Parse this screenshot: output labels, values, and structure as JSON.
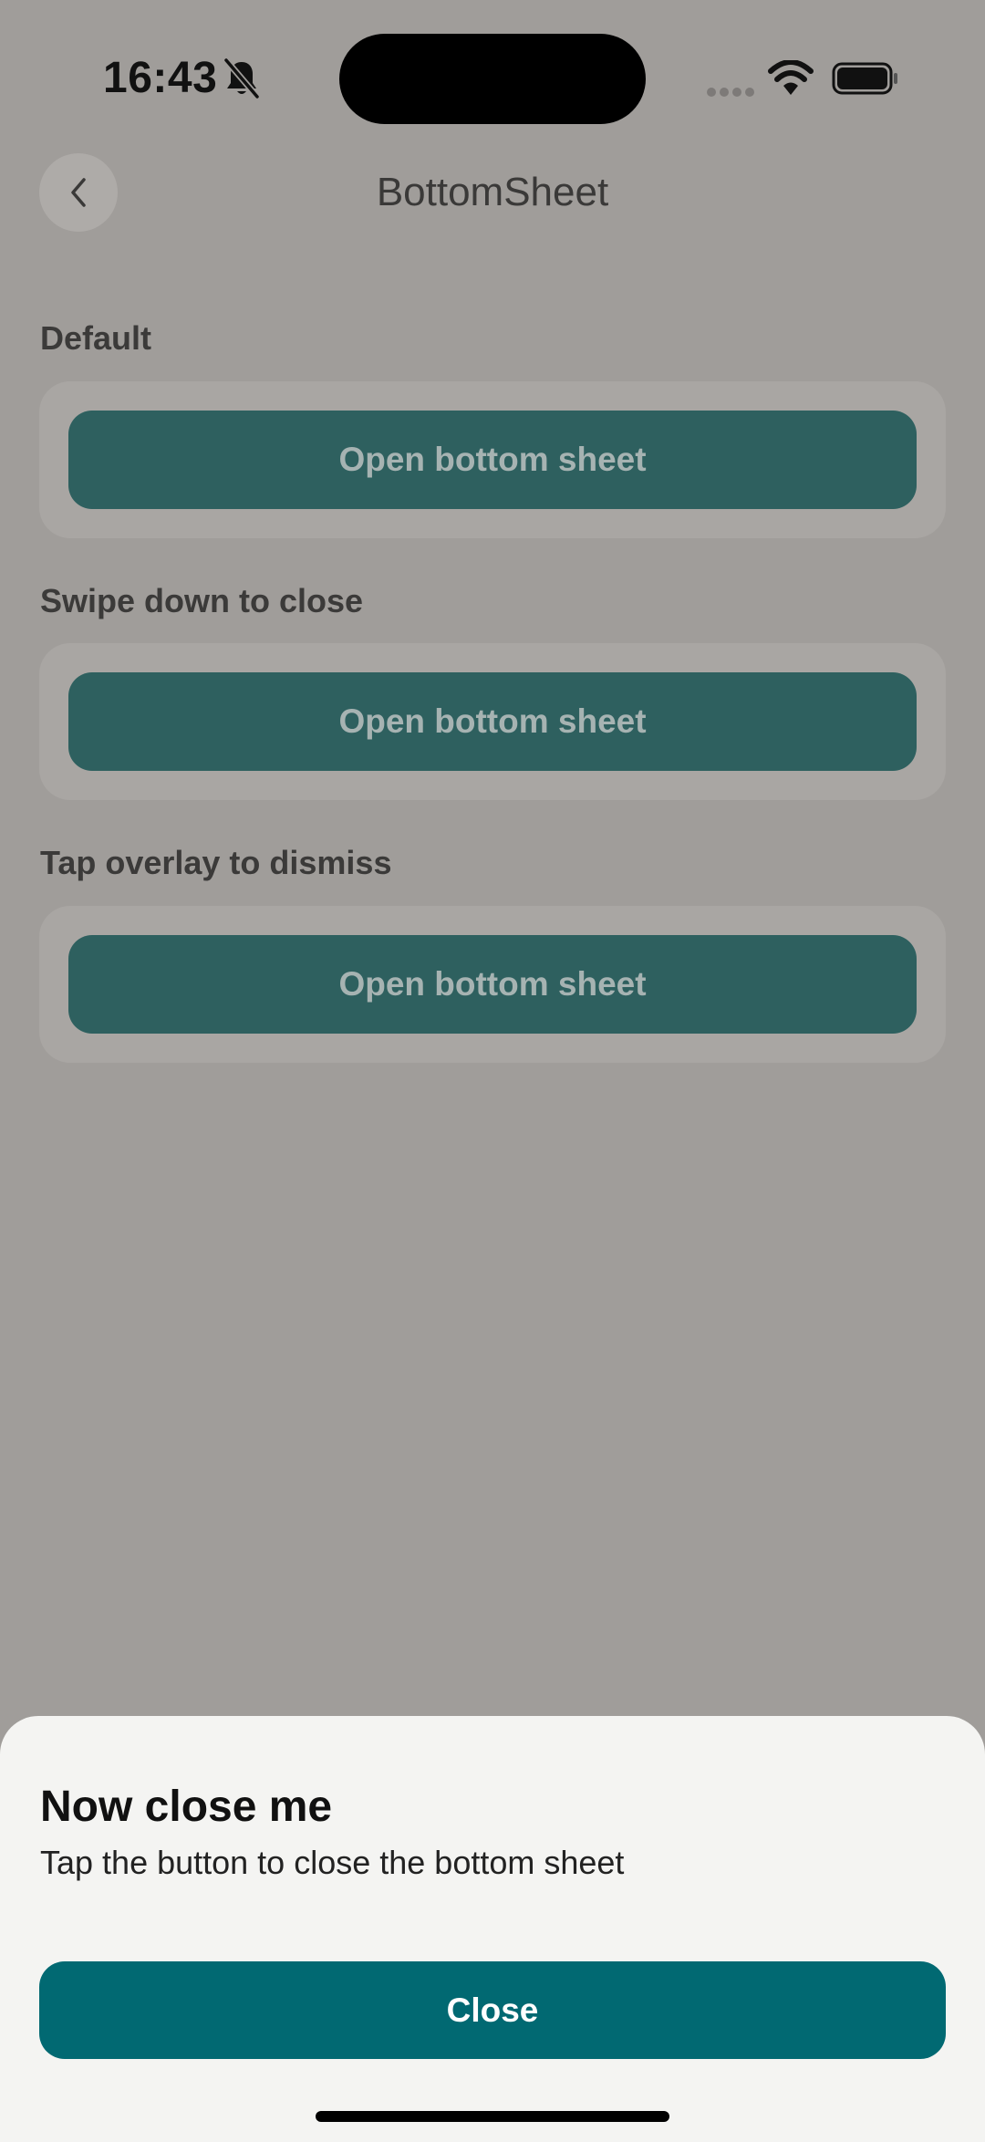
{
  "status_bar": {
    "time": "16:43",
    "icons": [
      "bell-slash-icon",
      "signal-dots-icon",
      "wifi-icon",
      "battery-icon"
    ]
  },
  "header": {
    "title": "BottomSheet",
    "back_icon": "chevron-left-icon"
  },
  "sections": [
    {
      "label": "Default",
      "button_label": "Open bottom sheet"
    },
    {
      "label": "Swipe down to close",
      "button_label": "Open bottom sheet"
    },
    {
      "label": "Tap overlay to dismiss",
      "button_label": "Open bottom sheet"
    }
  ],
  "bottom_sheet": {
    "title": "Now close me",
    "subtitle": "Tap the button to close the bottom sheet",
    "close_label": "Close"
  },
  "colors": {
    "overlay_background": "#a09d9a",
    "button_dimmed": "#2e605f",
    "button_primary": "#016972",
    "sheet_background": "#f4f4f2"
  }
}
